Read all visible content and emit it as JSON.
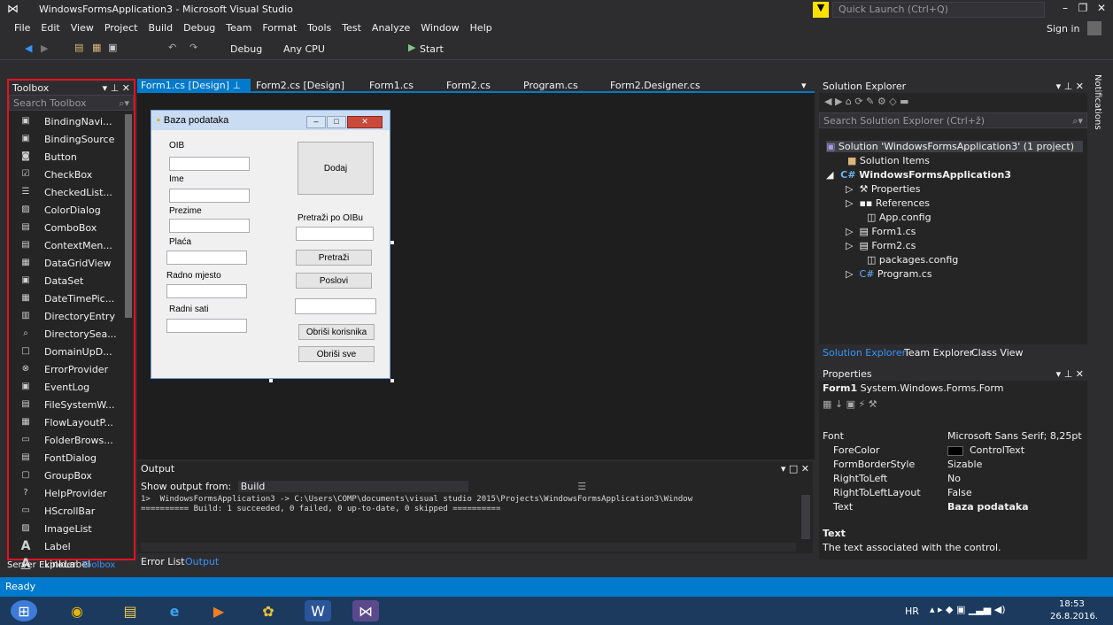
{
  "window": {
    "title": "WindowsFormsApplication3 - Microsoft Visual Studio",
    "quick_launch": "Quick Launch (Ctrl+Q)",
    "sign_in": "Sign in"
  },
  "menu": [
    "File",
    "Edit",
    "View",
    "Project",
    "Build",
    "Debug",
    "Team",
    "Format",
    "Tools",
    "Test",
    "Analyze",
    "Window",
    "Help"
  ],
  "toolbar": {
    "config": "Debug",
    "platform": "Any CPU",
    "start": "Start"
  },
  "toolbox": {
    "title": "Toolbox",
    "search_placeholder": "Search Toolbox",
    "items": [
      "BindingNavi...",
      "BindingSource",
      "Button",
      "CheckBox",
      "CheckedList...",
      "ColorDialog",
      "ComboBox",
      "ContextMen...",
      "DataGridView",
      "DataSet",
      "DateTimePic...",
      "DirectoryEntry",
      "DirectorySea...",
      "DomainUpD...",
      "ErrorProvider",
      "EventLog",
      "FileSystemW...",
      "FlowLayoutP...",
      "FolderBrows...",
      "FontDialog",
      "GroupBox",
      "HelpProvider",
      "HScrollBar",
      "ImageList",
      "Label",
      "LinkLabel"
    ],
    "bottom_tabs": [
      "Server Explorer",
      "Toolbox"
    ]
  },
  "doc_tabs": [
    "Form1.cs [Design]",
    "Form2.cs [Design]",
    "Form1.cs",
    "Form2.cs",
    "Program.cs",
    "Form2.Designer.cs"
  ],
  "form": {
    "title": "Baza podataka",
    "labels": {
      "oib": "OIB",
      "ime": "Ime",
      "prezime": "Prezime",
      "placa": "Plaća",
      "radno_mjesto": "Radno mjesto",
      "radni_sati": "Radni sati",
      "pretrazi_po": "Pretraži po OIBu"
    },
    "buttons": {
      "dodaj": "Dodaj",
      "pretrazi": "Pretraži",
      "poslovi": "Poslovi",
      "obrisi_korisnika": "Obriši korisnika",
      "obrisi_sve": "Obriši sve"
    }
  },
  "output": {
    "title": "Output",
    "show_from_label": "Show output from:",
    "show_from_value": "Build",
    "lines": [
      "1>  WindowsFormsApplication3 -> C:\\Users\\COMP\\documents\\visual studio 2015\\Projects\\WindowsFormsApplication3\\Window",
      "========== Build: 1 succeeded, 0 failed, 0 up-to-date, 0 skipped =========="
    ],
    "bottom_tabs": [
      "Error List",
      "Output"
    ]
  },
  "solution_explorer": {
    "title": "Solution Explorer",
    "search_placeholder": "Search Solution Explorer (Ctrl+ž)",
    "items": [
      "Solution 'WindowsFormsApplication3' (1 project)",
      "Solution Items",
      "WindowsFormsApplication3",
      "Properties",
      "References",
      "App.config",
      "Form1.cs",
      "Form2.cs",
      "packages.config",
      "Program.cs"
    ],
    "tabs": [
      "Solution Explorer",
      "Team Explorer",
      "Class View"
    ]
  },
  "properties": {
    "title": "Properties",
    "object": "Form1",
    "object_type": "System.Windows.Forms.Form",
    "rows": [
      {
        "name": "Font",
        "value": "Microsoft Sans Serif; 8,25pt"
      },
      {
        "name": "ForeColor",
        "value": "ControlText"
      },
      {
        "name": "FormBorderStyle",
        "value": "Sizable"
      },
      {
        "name": "RightToLeft",
        "value": "No"
      },
      {
        "name": "RightToLeftLayout",
        "value": "False"
      },
      {
        "name": "Text",
        "value": "Baza podataka"
      }
    ],
    "desc_title": "Text",
    "desc_text": "The text associated with the control."
  },
  "notifications": "Notifications",
  "status": "Ready",
  "taskbar": {
    "lang": "HR",
    "time": "18:53",
    "date": "26.8.2016."
  },
  "colors": {
    "accent": "#007acc",
    "highlight": "#e81123"
  }
}
